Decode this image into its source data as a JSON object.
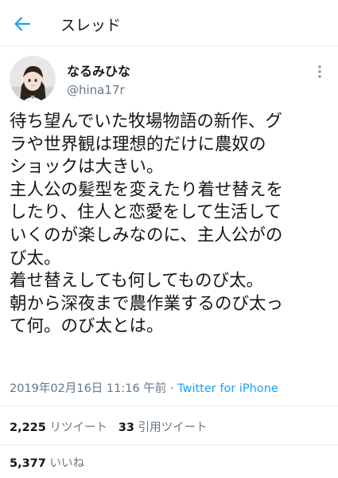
{
  "header": {
    "title": "スレッド",
    "back_icon": "arrow-left-icon",
    "accent_color": "#1da1f2"
  },
  "tweet": {
    "display_name": "なるみひな",
    "handle": "@hina17r",
    "text_lines": [
      "待ち望んでいた牧場物語の新作、グ",
      "ラや世界観は理想的だけに農奴の",
      "ショックは大きい。",
      "主人公の髪型を変えたり着せ替えを",
      "したり、住人と恋愛をして生活して",
      "いくのが楽しみなのに、主人公がの",
      "び太。",
      "着せ替えしても何してものび太。",
      "朝から深夜まで農作業するのび太っ",
      "て何。のび太とは。"
    ],
    "datetime": "2019年02月16日 11:16 午前",
    "separator": " · ",
    "source": "Twitter for iPhone"
  },
  "stats": {
    "retweet_count": "2,225",
    "retweet_label": " リツイート",
    "quote_count": "33",
    "quote_label": " 引用ツイート",
    "like_count": "5,377",
    "like_label": " いいね"
  }
}
